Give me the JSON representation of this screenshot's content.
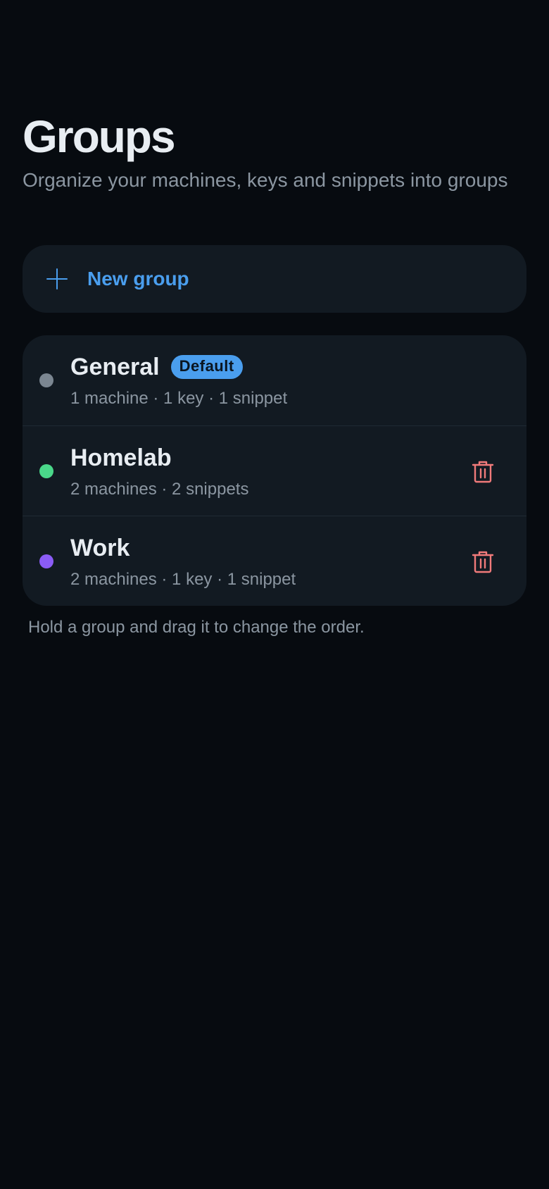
{
  "header": {
    "title": "Groups",
    "subtitle": "Organize your machines, keys and snippets into groups"
  },
  "new_group": {
    "label": "New group",
    "icon": "plus-icon"
  },
  "groups": [
    {
      "name": "General",
      "badge": "Default",
      "meta": "1 machine · 1 key · 1 snippet",
      "color": "#7b8691",
      "deletable": false
    },
    {
      "name": "Homelab",
      "meta": "2 machines · 2 snippets",
      "color": "#4ad88a",
      "deletable": true,
      "delete_icon": "trash-icon"
    },
    {
      "name": "Work",
      "meta": "2 machines · 1 key · 1 snippet",
      "color": "#8b5cf6",
      "deletable": true,
      "delete_icon": "trash-icon"
    }
  ],
  "hint": "Hold a group and drag it to change the order.",
  "colors": {
    "background": "#070b10",
    "card": "#121a22",
    "accent": "#4a9eee",
    "danger": "#f07a7a"
  }
}
